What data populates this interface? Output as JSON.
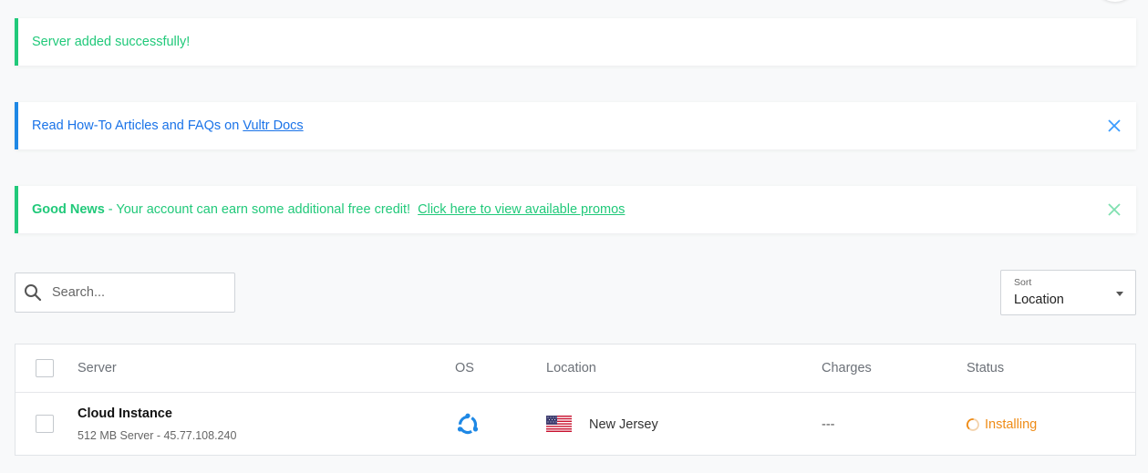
{
  "alerts": {
    "success": {
      "text": "Server added successfully!"
    },
    "info": {
      "text": "Read How-To Articles and FAQs on ",
      "link": "Vultr Docs"
    },
    "promo": {
      "bold": "Good News",
      "text": " - Your account can earn some additional free credit!  ",
      "link": "Click here to view available promos"
    }
  },
  "search": {
    "placeholder": "Search...",
    "value": ""
  },
  "sort": {
    "label": "Sort",
    "value": "Location"
  },
  "table": {
    "headers": {
      "server": "Server",
      "os": "OS",
      "location": "Location",
      "charges": "Charges",
      "status": "Status"
    },
    "rows": [
      {
        "name": "Cloud Instance",
        "details": "512 MB Server - 45.77.108.240",
        "os_icon": "ubuntu-icon",
        "flag": "us-flag-icon",
        "location": "New Jersey",
        "charges": "---",
        "status": "Installing"
      }
    ]
  },
  "colors": {
    "success": "#21c97a",
    "info": "#1a73e8",
    "status_installing": "#ef8c17",
    "os_icon": "#1e88e5"
  },
  "icons": {
    "search": "search-icon",
    "close": "close-icon",
    "caret": "chevron-down-icon",
    "status": "spinner-icon"
  }
}
